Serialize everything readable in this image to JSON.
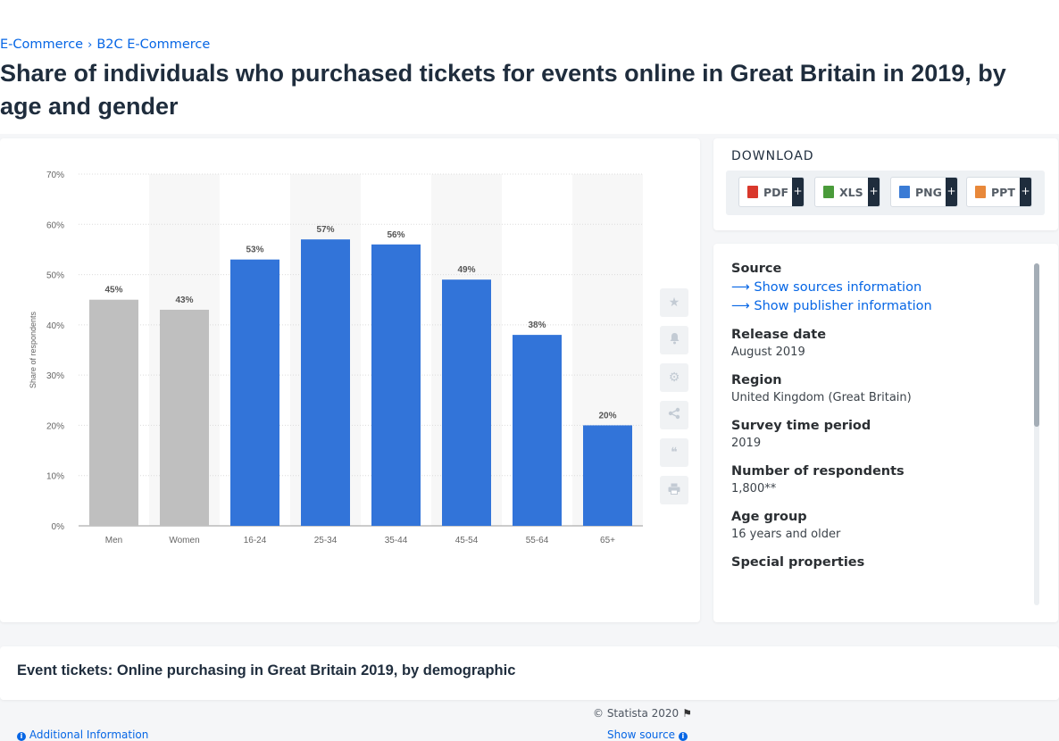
{
  "breadcrumb": {
    "item1": "E-Commerce",
    "item2": "B2C E-Commerce",
    "separator": "›"
  },
  "page": {
    "title": "Share of individuals who purchased tickets for events online in Great Britain in 2019, by age and gender"
  },
  "chart_data": {
    "type": "bar",
    "categories": [
      "Men",
      "Women",
      "16-24",
      "25-34",
      "35-44",
      "45-54",
      "55-64",
      "65+"
    ],
    "values": [
      45,
      43,
      53,
      57,
      56,
      49,
      38,
      20
    ],
    "data_labels": [
      "45%",
      "43%",
      "53%",
      "57%",
      "56%",
      "49%",
      "38%",
      "20%"
    ],
    "bar_colors": [
      "#bfbfbf",
      "#bfbfbf",
      "#3274d9",
      "#3274d9",
      "#3274d9",
      "#3274d9",
      "#3274d9",
      "#3274d9"
    ],
    "ylabel": "Share of respondents",
    "yticks": [
      "0%",
      "10%",
      "20%",
      "30%",
      "40%",
      "50%",
      "60%",
      "70%"
    ],
    "ylim": [
      0,
      70
    ],
    "grid": true,
    "alternating_column_bands": true
  },
  "chart_footer": {
    "copyright": "© Statista 2020",
    "additional_info": "Additional Information",
    "show_source": "Show source"
  },
  "tools": [
    {
      "icon": "star-icon",
      "glyph": "★"
    },
    {
      "icon": "bell-icon",
      "glyph": "🔔"
    },
    {
      "icon": "gear-icon",
      "glyph": "⚙"
    },
    {
      "icon": "share-icon",
      "glyph": "⤴"
    },
    {
      "icon": "quote-icon",
      "glyph": "❝"
    },
    {
      "icon": "print-icon",
      "glyph": "⎙"
    }
  ],
  "download": {
    "title": "DOWNLOAD",
    "buttons": [
      {
        "label": "PDF",
        "icon": "pdf-file-icon",
        "color": "#d9382c"
      },
      {
        "label": "XLS",
        "icon": "xls-file-icon",
        "color": "#4a9b3a"
      },
      {
        "label": "PNG",
        "icon": "png-file-icon",
        "color": "#3a7bd5"
      },
      {
        "label": "PPT",
        "icon": "ppt-file-icon",
        "color": "#e8883a"
      }
    ],
    "plus": "+"
  },
  "info": {
    "source_label": "Source",
    "show_sources": "Show sources information",
    "show_publisher": "Show publisher information",
    "release_date_label": "Release date",
    "release_date": "August 2019",
    "region_label": "Region",
    "region": "United Kingdom (Great Britain)",
    "survey_period_label": "Survey time period",
    "survey_period": "2019",
    "respondents_label": "Number of respondents",
    "respondents": "1,800**",
    "age_group_label": "Age group",
    "age_group": "16 years and older",
    "special_label": "Special properties"
  },
  "bottom": {
    "title": "Event tickets: Online purchasing in Great Britain 2019, by demographic"
  }
}
